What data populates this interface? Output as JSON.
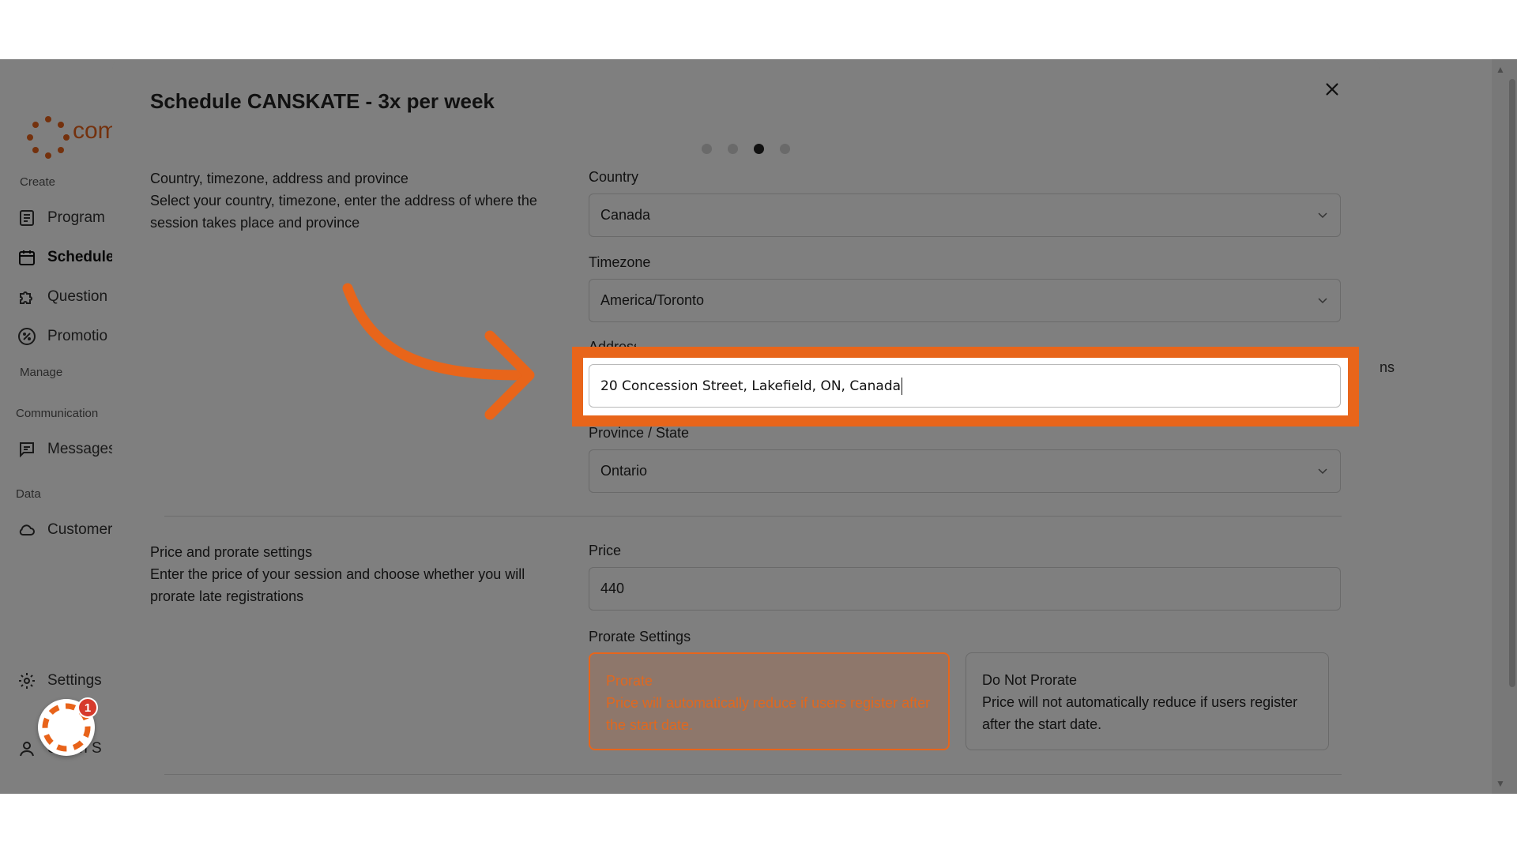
{
  "sidebar": {
    "logo_text": "com",
    "groups": {
      "create": "Create",
      "manage": "Manage",
      "communication": "Communication",
      "data": "Data"
    },
    "items": {
      "program": "Program",
      "schedule": "Schedule",
      "questions": "Question",
      "promotions": "Promotio",
      "messages": "Messages",
      "customers": "Customer",
      "settings": "Settings",
      "user": "Sarah S"
    },
    "notification_count": "1"
  },
  "background": {
    "right_text": "ns"
  },
  "modal": {
    "title": "Schedule CANSKATE - 3x per week",
    "steps": {
      "total": 4,
      "current": 3
    },
    "location_section": {
      "heading": "Country, timezone, address and province",
      "description": "Select your country, timezone, enter the address of where the session takes place and province"
    },
    "country": {
      "label": "Country",
      "value": "Canada"
    },
    "timezone": {
      "label": "Timezone",
      "value": "America/Toronto"
    },
    "address": {
      "label": "Address",
      "value": "20 Concession Street, Lakefield, ON, Canada"
    },
    "province": {
      "label": "Province / State",
      "value": "Ontario"
    },
    "price_section": {
      "heading": "Price and prorate settings",
      "description": "Enter the price of your session and choose whether you will prorate late registrations"
    },
    "price": {
      "label": "Price",
      "value": "440"
    },
    "prorate": {
      "label": "Prorate Settings",
      "options": [
        {
          "title": "Prorate",
          "description": "Price will automatically reduce if users register after the start date.",
          "selected": true
        },
        {
          "title": "Do Not Prorate",
          "description": "Price will not automatically reduce if users register after the start date.",
          "selected": false
        }
      ]
    }
  },
  "annotation": {
    "color": "#e8651a"
  }
}
